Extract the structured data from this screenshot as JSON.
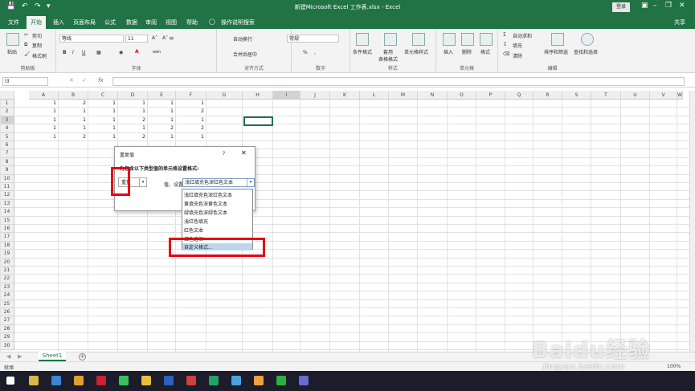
{
  "window": {
    "title": "新建Microsoft Excel 工作表.xlsx - Excel",
    "login": "登录",
    "quick_access": [
      "save-icon",
      "undo-icon",
      "redo-icon",
      "customize-icon"
    ]
  },
  "tabs": [
    "文件",
    "开始",
    "插入",
    "页面布局",
    "公式",
    "数据",
    "审阅",
    "视图",
    "帮助"
  ],
  "active_tab": "开始",
  "tell_me": "操作说明搜索",
  "share": "共享",
  "ribbon": {
    "clipboard": {
      "paste": "粘贴",
      "cut": "剪切",
      "copy": "复制",
      "format_painter": "格式刷",
      "label": "剪贴板"
    },
    "font": {
      "name": "等线",
      "size": "11",
      "label": "字体",
      "bold": "B",
      "italic": "I",
      "underline": "U",
      "wen": "wén",
      "color_glyph": "A"
    },
    "alignment": {
      "wrap": "自动换行",
      "merge": "合并后居中",
      "label": "对齐方式"
    },
    "number": {
      "format": "常规",
      "percent": "%",
      "comma": ",",
      "label": "数字"
    },
    "styles": {
      "conditional": "条件格式",
      "table": "套用\n表格格式",
      "cell": "单元格样式",
      "label": "样式"
    },
    "cells": {
      "insert": "插入",
      "delete": "删除",
      "format": "格式",
      "label": "单元格"
    },
    "editing": {
      "autosum": "自动求和",
      "fill": "填充",
      "clear": "清除",
      "sort": "排序和筛选",
      "find": "查找和选择",
      "label": "编辑"
    }
  },
  "formula_bar": {
    "name_box": "I3",
    "fx": "fx",
    "cancel": "✕",
    "enter": "✓",
    "value": ""
  },
  "columns": [
    "A",
    "B",
    "C",
    "D",
    "E",
    "F",
    "G",
    "H",
    "I",
    "J",
    "K",
    "L",
    "M",
    "N",
    "O",
    "P",
    "Q",
    "R",
    "S",
    "T",
    "U",
    "V",
    "W"
  ],
  "selected_column": "I",
  "rows": [
    "1",
    "2",
    "3",
    "4",
    "5",
    "6",
    "7",
    "8",
    "9",
    "10",
    "11",
    "12",
    "13",
    "14",
    "15",
    "16",
    "17",
    "18",
    "19",
    "20",
    "21",
    "22",
    "23",
    "24",
    "25",
    "26",
    "27",
    "28",
    "29",
    "30"
  ],
  "selected_row": "3",
  "cells": [
    [
      "1",
      "2",
      "1",
      "1",
      "1",
      "1"
    ],
    [
      "1",
      "1",
      "1",
      "1",
      "1",
      "2"
    ],
    [
      "1",
      "1",
      "1",
      "2",
      "1",
      "1"
    ],
    [
      "1",
      "1",
      "1",
      "1",
      "2",
      "2"
    ],
    [
      "1",
      "2",
      "1",
      "2",
      "1",
      "1"
    ]
  ],
  "dialog": {
    "title": "重复值",
    "help": "?",
    "close": "✕",
    "prompt": "为包含以下类型值的单元格设置格式:",
    "values_suffix": "值，设置为",
    "rule_selected": "重复",
    "format_selected": "浅红填充色深红色文本",
    "format_options": [
      "浅红填充色深红色文本",
      "黄填充色深黄色文本",
      "绿填充色深绿色文本",
      "浅红色填充",
      "红色文本",
      "红色边框",
      "自定义格式..."
    ],
    "highlighted_option": "自定义格式..."
  },
  "sheet_tab": "Sheet1",
  "status": {
    "ready": "就绪",
    "zoom": "100%"
  },
  "watermark": {
    "logo": "Baidu经验",
    "url": "jingyan.baidu.com"
  },
  "colors": {
    "excel_green": "#217346",
    "highlight_red": "#e60012"
  }
}
